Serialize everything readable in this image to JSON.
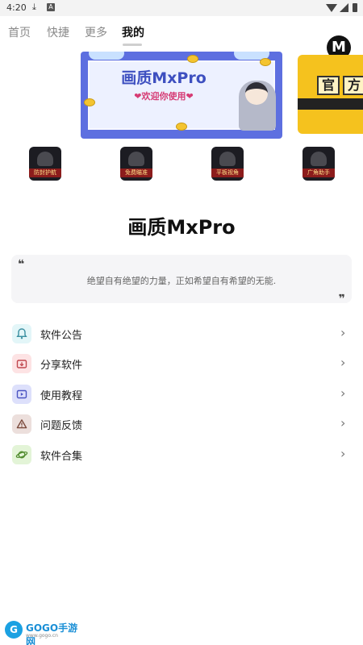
{
  "status_bar": {
    "time": "4:20",
    "icons": [
      "download-icon",
      "a-app-icon",
      "wifi-icon",
      "signal-icon",
      "battery-icon"
    ]
  },
  "tabs": {
    "items": [
      {
        "label": "首页",
        "active": false
      },
      {
        "label": "快捷",
        "active": false
      },
      {
        "label": "更多",
        "active": false
      },
      {
        "label": "我的",
        "active": true
      }
    ],
    "logo_text": "M"
  },
  "banner": {
    "title": "画质MxPro",
    "subtitle": "❤欢迎你使用❤",
    "next_banner_chars": [
      "官",
      "方"
    ]
  },
  "quick_actions": [
    {
      "label": "防封护航"
    },
    {
      "label": "免费瞄准"
    },
    {
      "label": "平板视角"
    },
    {
      "label": "广角助手"
    }
  ],
  "app_title": "画质MxPro",
  "quote": {
    "open_mark": "❝",
    "text": "绝望自有绝望的力量，正如希望自有希望的无能.",
    "close_mark": "❞"
  },
  "menu": [
    {
      "label": "软件公告",
      "icon": "bell-icon",
      "icon_bg": "#e3f6f8",
      "icon_color": "#3a8fa0"
    },
    {
      "label": "分享软件",
      "icon": "share-folder-icon",
      "icon_bg": "#fde3e4",
      "icon_color": "#c0484f"
    },
    {
      "label": "使用教程",
      "icon": "video-play-icon",
      "icon_bg": "#dde0fb",
      "icon_color": "#4b54c2"
    },
    {
      "label": "问题反馈",
      "icon": "warning-icon",
      "icon_bg": "#ecdfdc",
      "icon_color": "#7b4a3c"
    },
    {
      "label": "软件合集",
      "icon": "planet-icon",
      "icon_bg": "#e3f4d7",
      "icon_color": "#4f8a2c"
    }
  ],
  "menu_arrow": "›",
  "watermark": {
    "badge": "G",
    "name": "GOGO手游网",
    "url": "www.gogo.cn"
  }
}
